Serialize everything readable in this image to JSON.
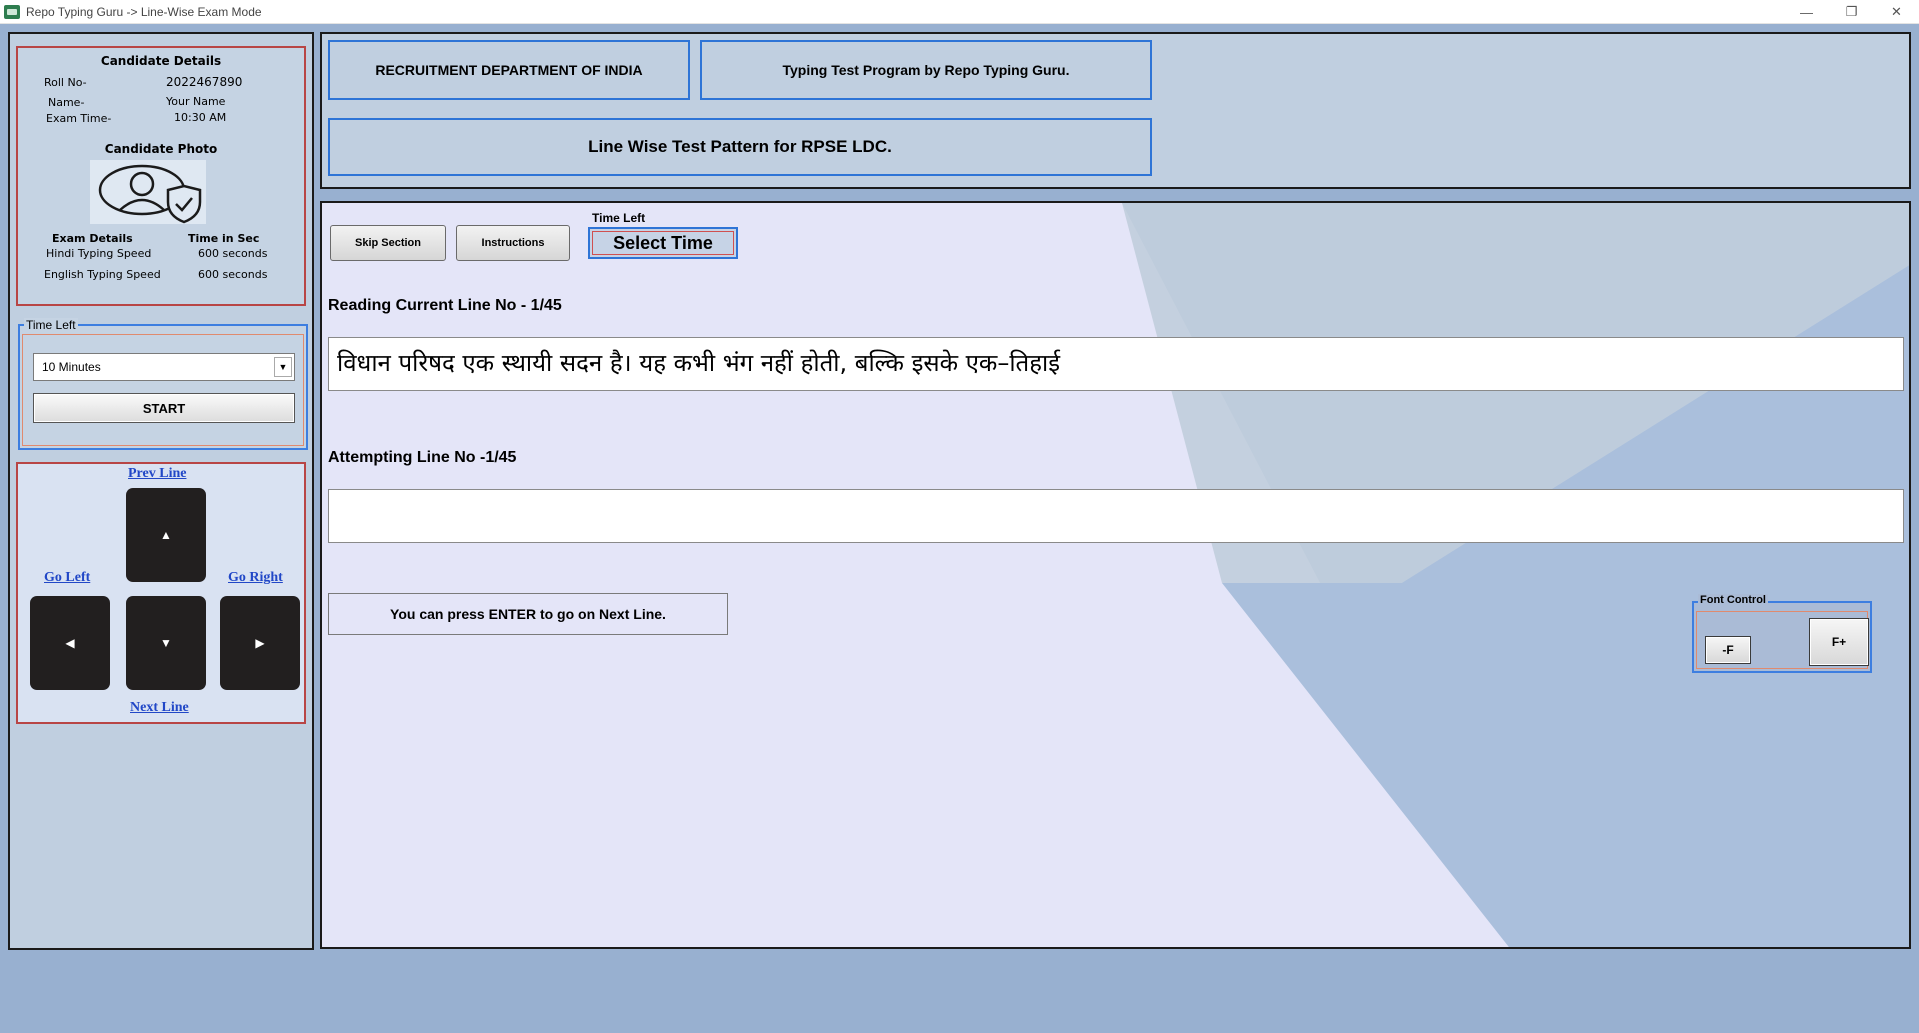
{
  "window": {
    "title": "Repo Typing Guru -> Line-Wise Exam Mode",
    "controls": {
      "minimize": "—",
      "restore": "❐",
      "close": "✕"
    }
  },
  "candidate": {
    "heading": "Candidate Details",
    "roll_label": "Roll No-",
    "roll_value": "2022467890",
    "name_label": "Name-",
    "name_value": "Your Name",
    "exam_time_label": "Exam Time-",
    "exam_time_value": "10:30 AM",
    "photo_heading": "Candidate Photo",
    "exam_details_heading": "Exam Details",
    "time_heading": "Time in Sec",
    "hindi_label": "Hindi Typing Speed",
    "hindi_value": "600 seconds",
    "english_label": "English Typing Speed",
    "english_value": "600 seconds"
  },
  "timer_panel": {
    "group_label": "Time Left",
    "selected_option": "10 Minutes",
    "start_label": "START"
  },
  "navigation": {
    "prev_line": "Prev Line",
    "go_left": "Go Left",
    "go_right": "Go Right",
    "next_line": "Next Line",
    "up_glyph": "▲",
    "down_glyph": "▼",
    "left_glyph": "◀",
    "right_glyph": "▶"
  },
  "header": {
    "department": "RECRUITMENT DEPARTMENT OF INDIA",
    "program": "Typing Test Program by Repo Typing Guru.",
    "pattern": "Line Wise Test Pattern for RPSE LDC."
  },
  "main": {
    "skip_label": "Skip Section",
    "instructions_label": "Instructions",
    "time_left_label": "Time Left",
    "select_time": "Select Time",
    "reading_label": "Reading Current Line No - 1/45",
    "reading_text": "विधान परिषद एक स्थायी सदन है। यह कभी भंग नहीं होती, बल्कि इसके एक–तिहाई",
    "attempting_label": "Attempting Line No -1/45",
    "attempt_value": "",
    "enter_hint": "You can press ENTER to go on Next Line."
  },
  "font_control": {
    "label": "Font Control",
    "decrease": "-F",
    "increase": "F+"
  }
}
